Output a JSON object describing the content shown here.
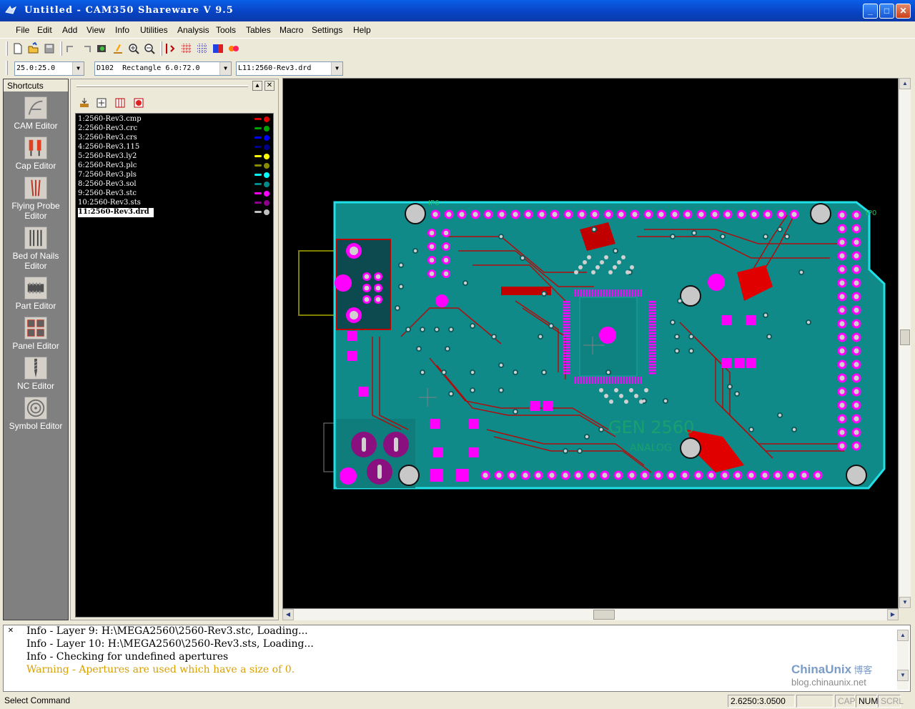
{
  "window": {
    "title": "Untitled - CAM350 Shareware V 9.5"
  },
  "menu": [
    "File",
    "Edit",
    "Add",
    "View",
    "Info",
    "Utilities",
    "Analysis",
    "Tools",
    "Tables",
    "Macro",
    "Settings",
    "Help"
  ],
  "combos": {
    "grid": "25.0:25.0",
    "aperture": "D102  Rectangle 6.0:72.0",
    "layer": "L11:2560-Rev3.drd"
  },
  "shortcuts": {
    "header": "Shortcuts",
    "items": [
      {
        "label": "CAM Editor",
        "icon": "cam-editor-icon"
      },
      {
        "label": "Cap Editor",
        "icon": "cap-editor-icon"
      },
      {
        "label": "Flying Probe Editor",
        "icon": "flying-probe-icon"
      },
      {
        "label": "Bed of Nails Editor",
        "icon": "bed-of-nails-icon"
      },
      {
        "label": "Part Editor",
        "icon": "part-editor-icon"
      },
      {
        "label": "Panel Editor",
        "icon": "panel-editor-icon"
      },
      {
        "label": "NC Editor",
        "icon": "nc-editor-icon"
      },
      {
        "label": "Symbol Editor",
        "icon": "symbol-editor-icon"
      }
    ]
  },
  "layers": [
    {
      "name": "1:2560-Rev3.cmp",
      "color": "#e00000"
    },
    {
      "name": "2:2560-Rev3.crc",
      "color": "#00a000"
    },
    {
      "name": "3:2560-Rev3.crs",
      "color": "#0000ff"
    },
    {
      "name": "4:2560-Rev3.115",
      "color": "#00008a"
    },
    {
      "name": "5:2560-Rev3.ly2",
      "color": "#ffff00"
    },
    {
      "name": "6:2560-Rev3.plc",
      "color": "#8a8a00"
    },
    {
      "name": "7:2560-Rev3.pls",
      "color": "#00ffff"
    },
    {
      "name": "8:2560-Rev3.sol",
      "color": "#008a8a"
    },
    {
      "name": "9:2560-Rev3.stc",
      "color": "#ff00ff"
    },
    {
      "name": "10:2560-Rev3.sts",
      "color": "#8a008a"
    },
    {
      "name": "11:2560-Rev3.drd",
      "color": "#c0c0c0",
      "selected": true
    }
  ],
  "board": {
    "silk_labels": [
      "IP6",
      "IP0"
    ]
  },
  "output": {
    "lines": [
      {
        "text": "Info - Layer 9: H:\\MEGA2560\\2560-Rev3.stc, Loading...",
        "kind": "info"
      },
      {
        "text": "Info - Layer 10: H:\\MEGA2560\\2560-Rev3.sts, Loading...",
        "kind": "info"
      },
      {
        "text": "Info - Checking for undefined apertures",
        "kind": "info"
      },
      {
        "text": "Warning - Apertures are used which have a size of 0.",
        "kind": "warning"
      }
    ],
    "warning_color": "#d8a000"
  },
  "watermark": {
    "brand": "ChinaUnix",
    "suffix": "博客",
    "url": "blog.chinaunix.net"
  },
  "status": {
    "prompt": "Select Command",
    "coords": "2.6250:3.0500",
    "cap": "CAP",
    "num": "NUM",
    "scrl": "SCRL"
  },
  "colors": {
    "pcb_board": "#108a88",
    "pcb_outline": "#20e0e8",
    "pad": "#ff00ff",
    "trace": "#c00000",
    "title_bar": "#0a50d8"
  }
}
